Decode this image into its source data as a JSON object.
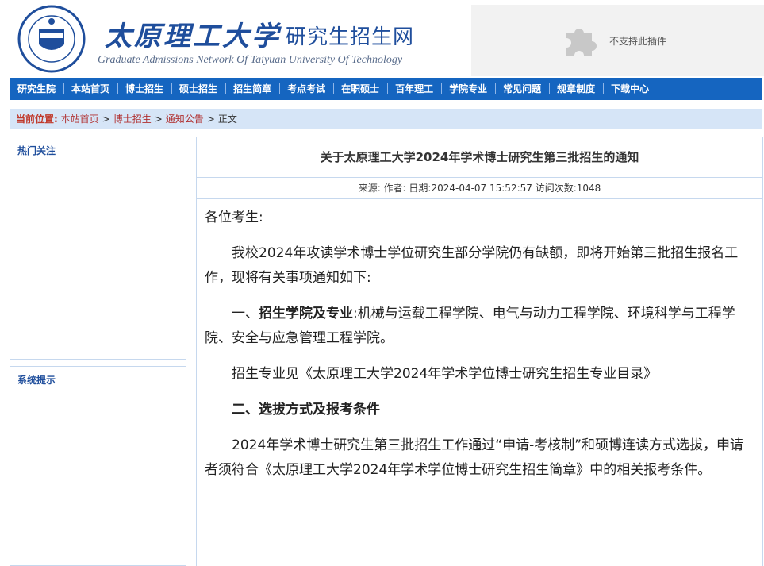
{
  "header": {
    "logo_seal_year": "1902",
    "logo_seal_text": "TAIYUAN UNIVERSITY OF TECHNOLOGY",
    "logo_cn": "太原理工大学",
    "site_name": "研究生招生网",
    "site_name_en": "Graduate Admissions Network Of Taiyuan University Of Technology",
    "plugin_message": "不支持此插件",
    "brand_color": "#1f4e9c"
  },
  "nav": {
    "items": [
      "研究生院",
      "本站首页",
      "博士招生",
      "硕士招生",
      "招生简章",
      "考点考试",
      "在职硕士",
      "百年理工",
      "学院专业",
      "常见问题",
      "规章制度",
      "下载中心"
    ],
    "bg_color": "#1565c0"
  },
  "breadcrumb": {
    "label": "当前位置:",
    "links": [
      "本站首页",
      "博士招生",
      "通知公告"
    ],
    "separator": ">",
    "current": "正文"
  },
  "sidebar": {
    "hot_title": "热门关注",
    "notice_title": "系统提示"
  },
  "article": {
    "title": "关于太原理工大学2024年学术博士研究生第三批招生的通知",
    "meta": "来源:  作者:  日期:2024-04-07 15:52:57 访问次数:1048",
    "greeting": "各位考生:",
    "p1": "我校2024年攻读学术博士学位研究生部分学院仍有缺额，即将开始第三批招生报名工作，现将有关事项通知如下:",
    "s1_heading_prefix": "一、",
    "s1_heading": "招生学院及专业",
    "s1_text": ":机械与运载工程学院、电气与动力工程学院、环境科学与工程学院、安全与应急管理工程学院。",
    "p2": "招生专业见《太原理工大学2024年学术学位博士研究生招生专业目录》",
    "s2_heading": "二、选拔方式及报考条件",
    "p3": "2024年学术博士研究生第三批招生工作通过“申请-考核制”和硕博连读方式选拔，申请者须符合《太原理工大学2024年学术学位博士研究生招生简章》中的相关报考条件。"
  }
}
